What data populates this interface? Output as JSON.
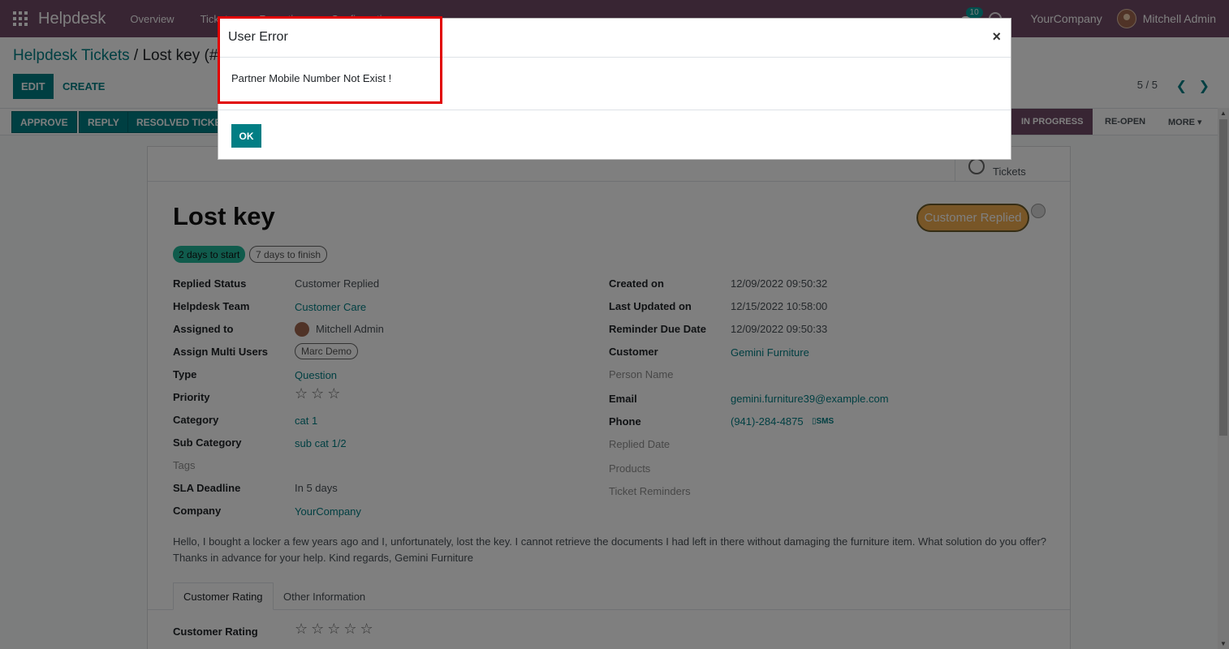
{
  "nav": {
    "brand": "Helpdesk",
    "menu": [
      "Overview",
      "Tickets",
      "Reporting",
      "Configuration"
    ],
    "notification_count": "10",
    "company": "YourCompany",
    "user": "Mitchell Admin"
  },
  "breadcrumb": {
    "parent": "Helpdesk Tickets",
    "separator": " / ",
    "current": "Lost key (#6"
  },
  "controls": {
    "edit": "EDIT",
    "create": "CREATE",
    "pager": "5 / 5",
    "prev": "❮",
    "next": "❯"
  },
  "statusbar": {
    "buttons": [
      "APPROVE",
      "REPLY",
      "RESOLVED TICKET"
    ],
    "stages": [
      "IN PROGRESS",
      "RE-OPEN",
      "MORE ▾"
    ],
    "active_stage": "IN PROGRESS"
  },
  "smart_button": {
    "label": "Tickets"
  },
  "ticket": {
    "title": "Lost key",
    "status": "Customer Replied",
    "tag_start": "2 days to start",
    "tag_finish": "7 days to finish"
  },
  "left_fields": [
    {
      "label": "Replied Status",
      "value": "Customer Replied"
    },
    {
      "label": "Helpdesk Team",
      "value": "Customer Care"
    },
    {
      "label": "Assigned to",
      "value": "Mitchell Admin"
    },
    {
      "label": "Assign Multi Users",
      "value": "Marc Demo"
    },
    {
      "label": "Type",
      "value": "Question"
    },
    {
      "label": "Priority",
      "value": "☆☆☆"
    },
    {
      "label": "Category",
      "value": "cat 1"
    },
    {
      "label": "Sub Category",
      "value": "sub cat 1/2"
    },
    {
      "label": "Tags",
      "value": ""
    },
    {
      "label": "SLA Deadline",
      "value": "In 5 days"
    },
    {
      "label": "Company",
      "value": "YourCompany"
    }
  ],
  "right_fields": [
    {
      "label": "Created on",
      "value": "12/09/2022 09:50:32"
    },
    {
      "label": "Last Updated on",
      "value": "12/15/2022 10:58:00"
    },
    {
      "label": "Reminder Due Date",
      "value": "12/09/2022 09:50:33"
    },
    {
      "label": "Customer",
      "value": "Gemini Furniture"
    },
    {
      "label": "Person Name",
      "value": ""
    },
    {
      "label": "Email",
      "value": "gemini.furniture39@example.com"
    },
    {
      "label": "Phone",
      "value": "(941)-284-4875"
    },
    {
      "label": "Replied Date",
      "value": ""
    },
    {
      "label": "Products",
      "value": ""
    },
    {
      "label": "Ticket Reminders",
      "value": ""
    }
  ],
  "sms_label": "▯SMS",
  "description_line1": "Hello, I bought a locker a few years ago and I, unfortunately, lost the key. I cannot retrieve the documents I had left in there without damaging the furniture item. What solution do you offer?",
  "description_line2": "Thanks in advance for your help. Kind regards, Gemini Furniture",
  "tabs": [
    "Customer Rating",
    "Other Information"
  ],
  "rating": {
    "label": "Customer Rating",
    "stars": "☆☆☆☆☆"
  },
  "modal": {
    "title": "User Error",
    "close": "×",
    "message": "Partner Mobile Number Not Exist !",
    "ok": "OK"
  },
  "colors": {
    "primary": "#714B67",
    "accent": "#017E84",
    "highlight": "#e10000",
    "status": "#f0ad4e"
  }
}
